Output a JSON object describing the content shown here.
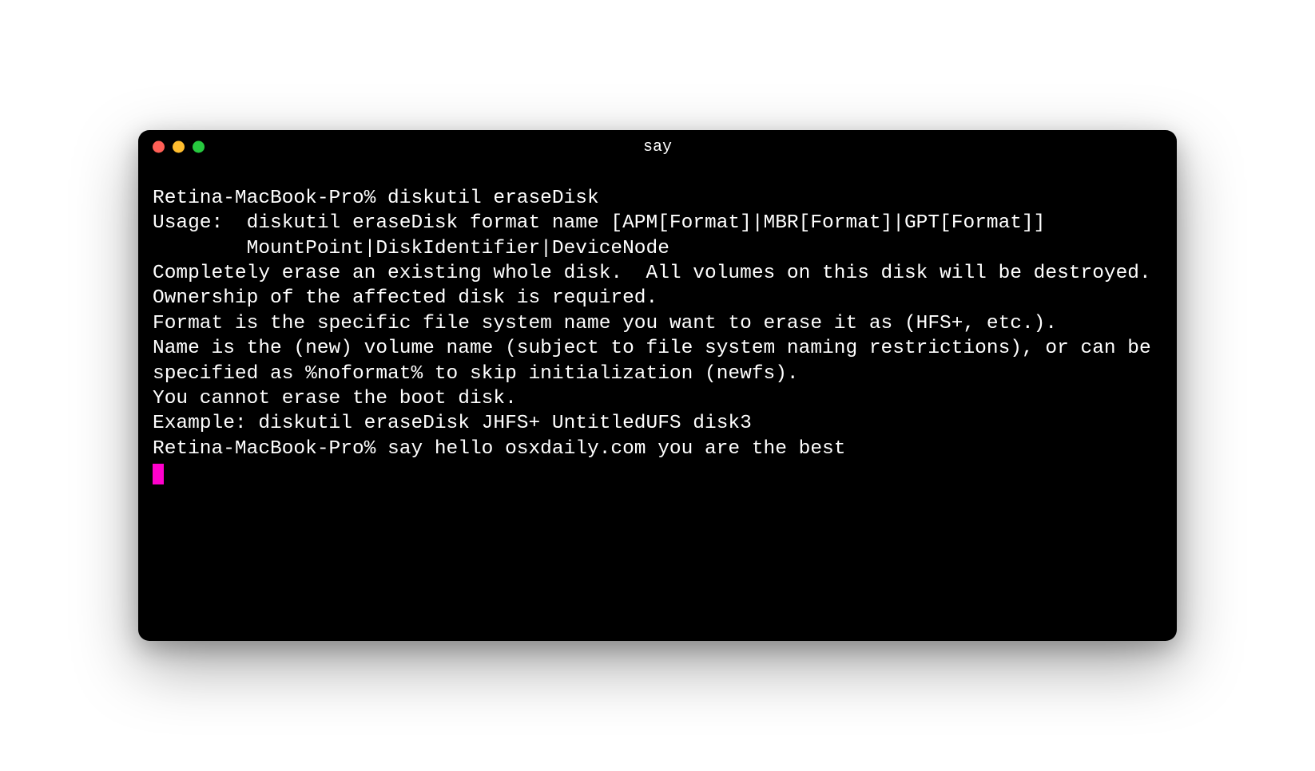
{
  "window": {
    "title": "say"
  },
  "terminal": {
    "lines": [
      "Retina-MacBook-Pro% diskutil eraseDisk",
      "Usage:  diskutil eraseDisk format name [APM[Format]|MBR[Format]|GPT[Format]]",
      "        MountPoint|DiskIdentifier|DeviceNode",
      "Completely erase an existing whole disk.  All volumes on this disk will be destroyed.  Ownership of the affected disk is required.",
      "Format is the specific file system name you want to erase it as (HFS+, etc.).",
      "Name is the (new) volume name (subject to file system naming restrictions), or can be specified as %noformat% to skip initialization (newfs).",
      "You cannot erase the boot disk.",
      "Example: diskutil eraseDisk JHFS+ UntitledUFS disk3",
      "Retina-MacBook-Pro% say hello osxdaily.com you are the best"
    ]
  },
  "colors": {
    "cursor": "#ff00cc",
    "background": "#000000",
    "foreground": "#ffffff",
    "close": "#ff5f56",
    "minimize": "#ffbd2e",
    "zoom": "#27c93f"
  }
}
